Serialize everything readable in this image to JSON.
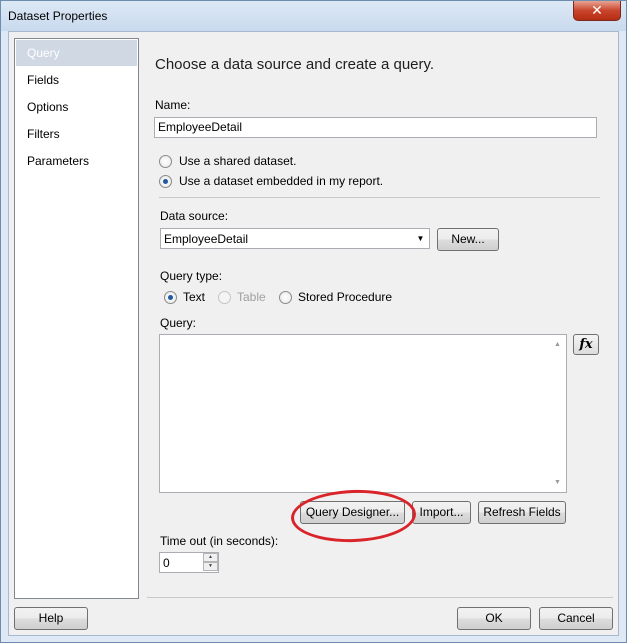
{
  "window": {
    "title": "Dataset Properties",
    "close_glyph": "✕"
  },
  "nav": {
    "items": [
      {
        "label": "Query",
        "selected": true
      },
      {
        "label": "Fields"
      },
      {
        "label": "Options"
      },
      {
        "label": "Filters"
      },
      {
        "label": "Parameters"
      }
    ]
  },
  "content": {
    "heading": "Choose a data source and create a query.",
    "name_label": "Name:",
    "name_value": "EmployeeDetail",
    "radio_shared": "Use a shared dataset.",
    "radio_embedded": "Use a dataset embedded in my report.",
    "datasource_label": "Data source:",
    "datasource_value": "EmployeeDetail",
    "new_button": "New...",
    "query_type_label": "Query type:",
    "query_type_text": "Text",
    "query_type_table": "Table",
    "query_type_stored": "Stored Procedure",
    "query_label": "Query:",
    "query_value": "",
    "fx_button": "fx",
    "query_designer_button": "Query Designer...",
    "import_button": "Import...",
    "refresh_fields_button": "Refresh Fields",
    "timeout_label": "Time out (in seconds):",
    "timeout_value": "0"
  },
  "footer": {
    "help_button": "Help",
    "ok_button": "OK",
    "cancel_button": "Cancel"
  },
  "colors": {
    "annotation": "#d9242a",
    "nav_selected": "#cfd8e3",
    "radio_selected": "#1d5aa1"
  }
}
